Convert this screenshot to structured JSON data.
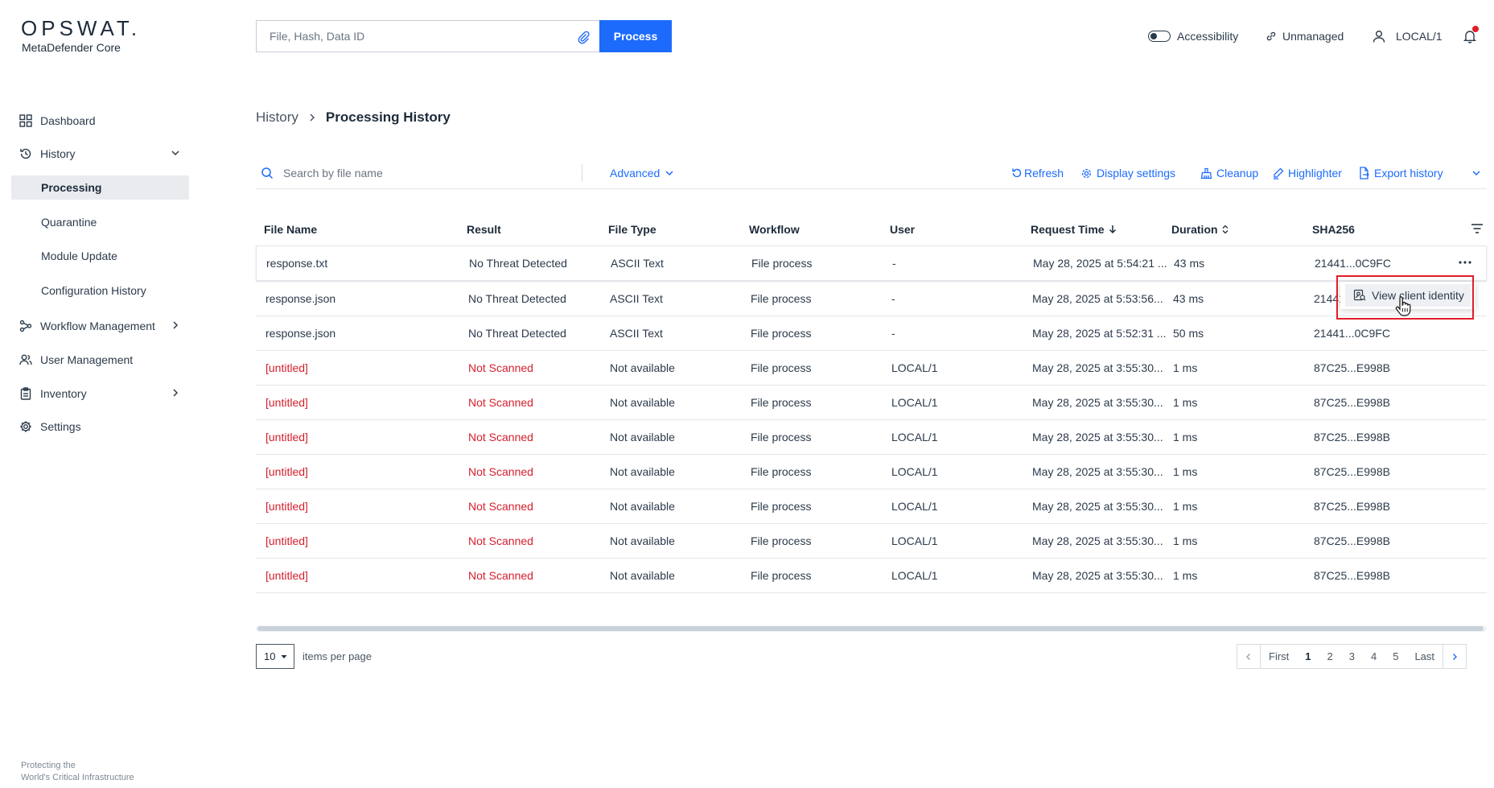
{
  "brand": {
    "name": "OPSWAT.",
    "product": "MetaDefender Core",
    "tagline_1": "Protecting the",
    "tagline_2": "World's Critical Infrastructure"
  },
  "topbar": {
    "search_placeholder": "File, Hash, Data ID",
    "process_label": "Process",
    "accessibility_label": "Accessibility",
    "unmanaged_label": "Unmanaged",
    "user_label": "LOCAL/1"
  },
  "sidebar": {
    "dashboard": "Dashboard",
    "history": "History",
    "history_children": [
      "Processing",
      "Quarantine",
      "Module Update",
      "Configuration History"
    ],
    "workflow": "Workflow Management",
    "users": "User Management",
    "inventory": "Inventory",
    "settings": "Settings"
  },
  "breadcrumb": {
    "parent": "History",
    "current": "Processing History"
  },
  "toolbar": {
    "search_placeholder": "Search by file name",
    "advanced": "Advanced",
    "refresh": "Refresh",
    "display_settings": "Display settings",
    "cleanup": "Cleanup",
    "highlighter": "Highlighter",
    "export_history": "Export history"
  },
  "table": {
    "headers": [
      "File Name",
      "Result",
      "File Type",
      "Workflow",
      "User",
      "Request Time",
      "Duration",
      "SHA256"
    ],
    "rows": [
      [
        "response.txt",
        "No Threat Detected",
        "ASCII Text",
        "File process",
        "-",
        "May 28, 2025 at 5:54:21 ...",
        "43 ms",
        "21441...0C9FC"
      ],
      [
        "response.json",
        "No Threat Detected",
        "ASCII Text",
        "File process",
        "-",
        "May 28, 2025 at 5:53:56...",
        "43 ms",
        "21441"
      ],
      [
        "response.json",
        "No Threat Detected",
        "ASCII Text",
        "File process",
        "-",
        "May 28, 2025 at 5:52:31 ...",
        "50 ms",
        "21441...0C9FC"
      ],
      [
        "[untitled]",
        "Not Scanned",
        "Not available",
        "File process",
        "LOCAL/1",
        "May 28, 2025 at 3:55:30...",
        "1 ms",
        "87C25...E998B"
      ],
      [
        "[untitled]",
        "Not Scanned",
        "Not available",
        "File process",
        "LOCAL/1",
        "May 28, 2025 at 3:55:30...",
        "1 ms",
        "87C25...E998B"
      ],
      [
        "[untitled]",
        "Not Scanned",
        "Not available",
        "File process",
        "LOCAL/1",
        "May 28, 2025 at 3:55:30...",
        "1 ms",
        "87C25...E998B"
      ],
      [
        "[untitled]",
        "Not Scanned",
        "Not available",
        "File process",
        "LOCAL/1",
        "May 28, 2025 at 3:55:30...",
        "1 ms",
        "87C25...E998B"
      ],
      [
        "[untitled]",
        "Not Scanned",
        "Not available",
        "File process",
        "LOCAL/1",
        "May 28, 2025 at 3:55:30...",
        "1 ms",
        "87C25...E998B"
      ],
      [
        "[untitled]",
        "Not Scanned",
        "Not available",
        "File process",
        "LOCAL/1",
        "May 28, 2025 at 3:55:30...",
        "1 ms",
        "87C25...E998B"
      ],
      [
        "[untitled]",
        "Not Scanned",
        "Not available",
        "File process",
        "LOCAL/1",
        "May 28, 2025 at 3:55:30...",
        "1 ms",
        "87C25...E998B"
      ]
    ]
  },
  "context_menu": {
    "item": "View client identity"
  },
  "pagination": {
    "per_page": "10",
    "per_page_label": "items per page",
    "first": "First",
    "pages": [
      "1",
      "2",
      "3",
      "4",
      "5"
    ],
    "last": "Last"
  },
  "colors": {
    "accent": "#1d6bfc",
    "danger": "#d51f2c",
    "active_bg": "#e9ebef"
  }
}
